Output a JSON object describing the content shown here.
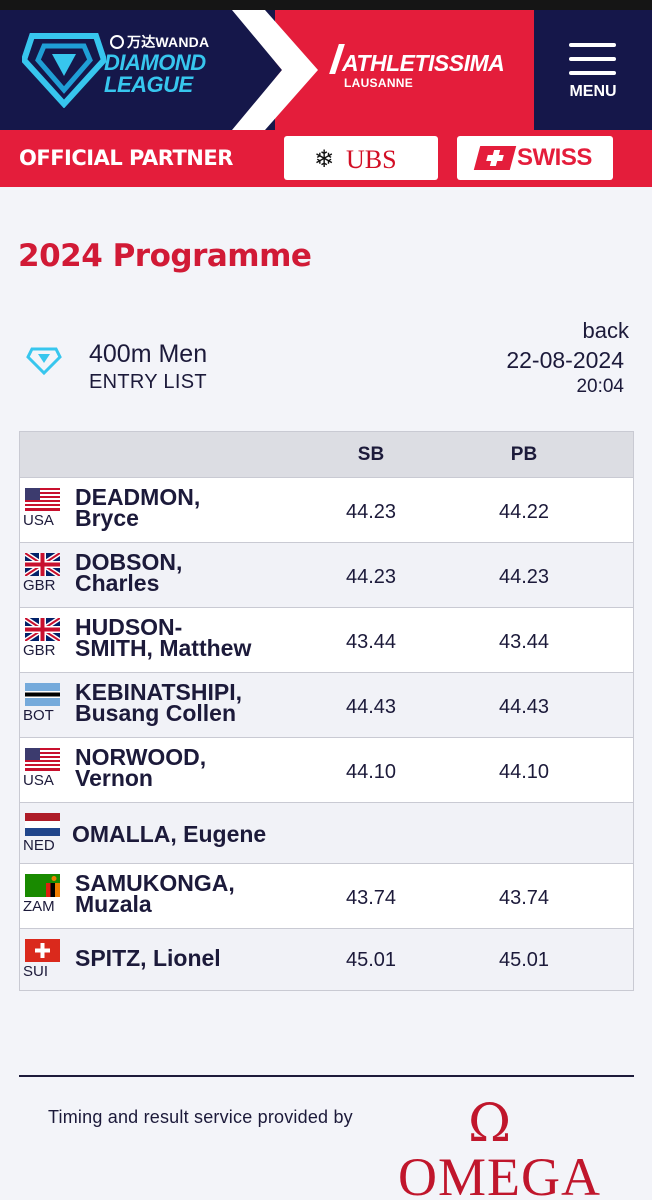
{
  "header": {
    "sponsor": "万达WANDA",
    "brand_line1": "DIAMOND",
    "brand_line2": "LEAGUE",
    "meeting_title": "ATHLETISSIMA",
    "meeting_sub": "LAUSANNE",
    "menu_label": "MENU"
  },
  "partner": {
    "label": "OFFICIAL PARTNER",
    "partners": [
      "UBS",
      "SWISS"
    ]
  },
  "page": {
    "title": "2024 Programme"
  },
  "event": {
    "name": "400m Men",
    "subtitle": "ENTRY LIST",
    "back": "back",
    "date": "22-08-2024",
    "time": "20:04"
  },
  "table": {
    "columns": [
      "SB",
      "PB"
    ],
    "rows": [
      {
        "country": "USA",
        "name_line1": "DEADMON,",
        "name_line2": "Bryce",
        "sb": "44.23",
        "pb": "44.22"
      },
      {
        "country": "GBR",
        "name_line1": "DOBSON,",
        "name_line2": "Charles",
        "sb": "44.23",
        "pb": "44.23"
      },
      {
        "country": "GBR",
        "name_line1": "HUDSON-",
        "name_line2": "SMITH, Matthew",
        "sb": "43.44",
        "pb": "43.44"
      },
      {
        "country": "BOT",
        "name_line1": "KEBINATSHIPI,",
        "name_line2": "Busang Collen",
        "sb": "44.43",
        "pb": "44.43"
      },
      {
        "country": "USA",
        "name_line1": "NORWOOD,",
        "name_line2": "Vernon",
        "sb": "44.10",
        "pb": "44.10"
      },
      {
        "country": "NED",
        "name_line1": "OMALLA, Eugene",
        "name_line2": "",
        "sb": "",
        "pb": ""
      },
      {
        "country": "ZAM",
        "name_line1": "SAMUKONGA,",
        "name_line2": "Muzala",
        "sb": "43.74",
        "pb": "43.74"
      },
      {
        "country": "SUI",
        "name_line1": "SPITZ, Lionel",
        "name_line2": "",
        "sb": "45.01",
        "pb": "45.01"
      }
    ]
  },
  "footer": {
    "timing_text": "Timing and result service provided by",
    "timing_brand": "OMEGA",
    "timing_symbol": "Ω"
  },
  "colors": {
    "navy": "#15174a",
    "red": "#e41d3b",
    "cyan": "#37c6ee",
    "title_red": "#d11a36"
  }
}
